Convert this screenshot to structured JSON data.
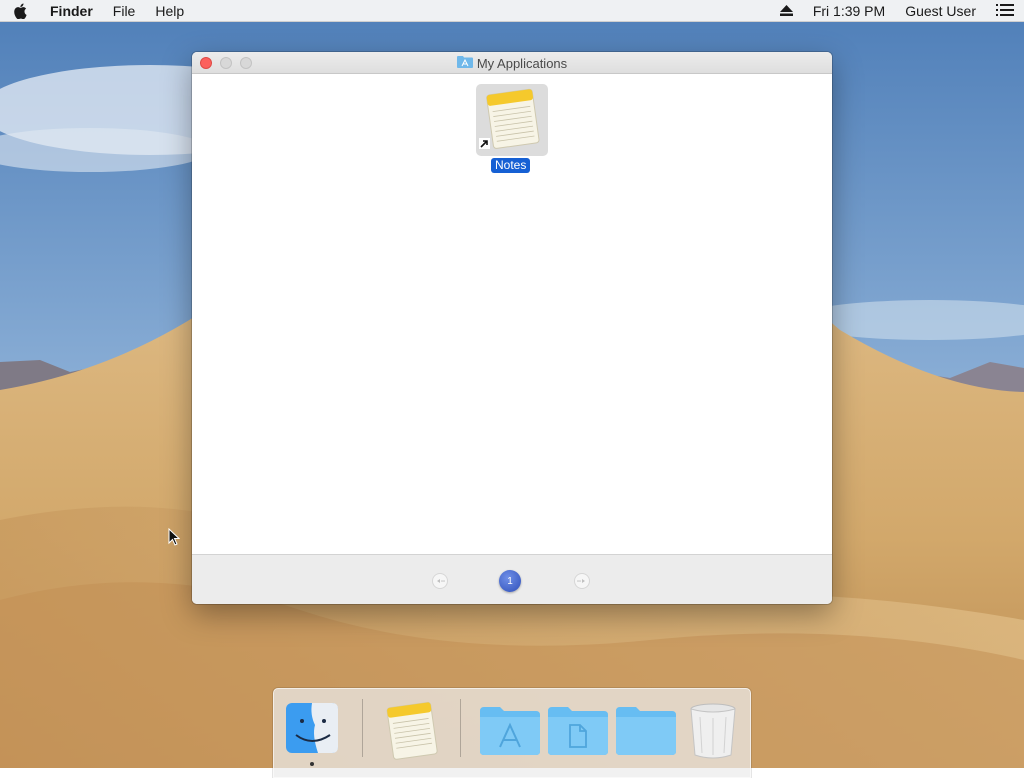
{
  "menubar": {
    "apple_icon": "apple-logo-icon",
    "app_name": "Finder",
    "menus": [
      "File",
      "Help"
    ],
    "clock": "Fri 1:39 PM",
    "user": "Guest User",
    "eject_icon": "eject-icon",
    "list_icon": "list-icon"
  },
  "window": {
    "title": "My Applications",
    "title_icon": "applications-folder-icon",
    "items": [
      {
        "label": "Notes",
        "icon": "notes-app-icon",
        "alias": true,
        "selected": true
      }
    ],
    "pagination": {
      "current_page": "1",
      "prev_icon": "page-prev-icon",
      "next_icon": "page-next-icon"
    }
  },
  "dock": {
    "items": [
      "finder-icon",
      "notes-app-icon",
      "applications-folder-icon",
      "documents-folder-icon",
      "downloads-folder-icon",
      "trash-icon"
    ]
  },
  "colors": {
    "selection": "#1660d4",
    "close_button": "#fc605c",
    "page_indicator": "#3a5bc7"
  }
}
